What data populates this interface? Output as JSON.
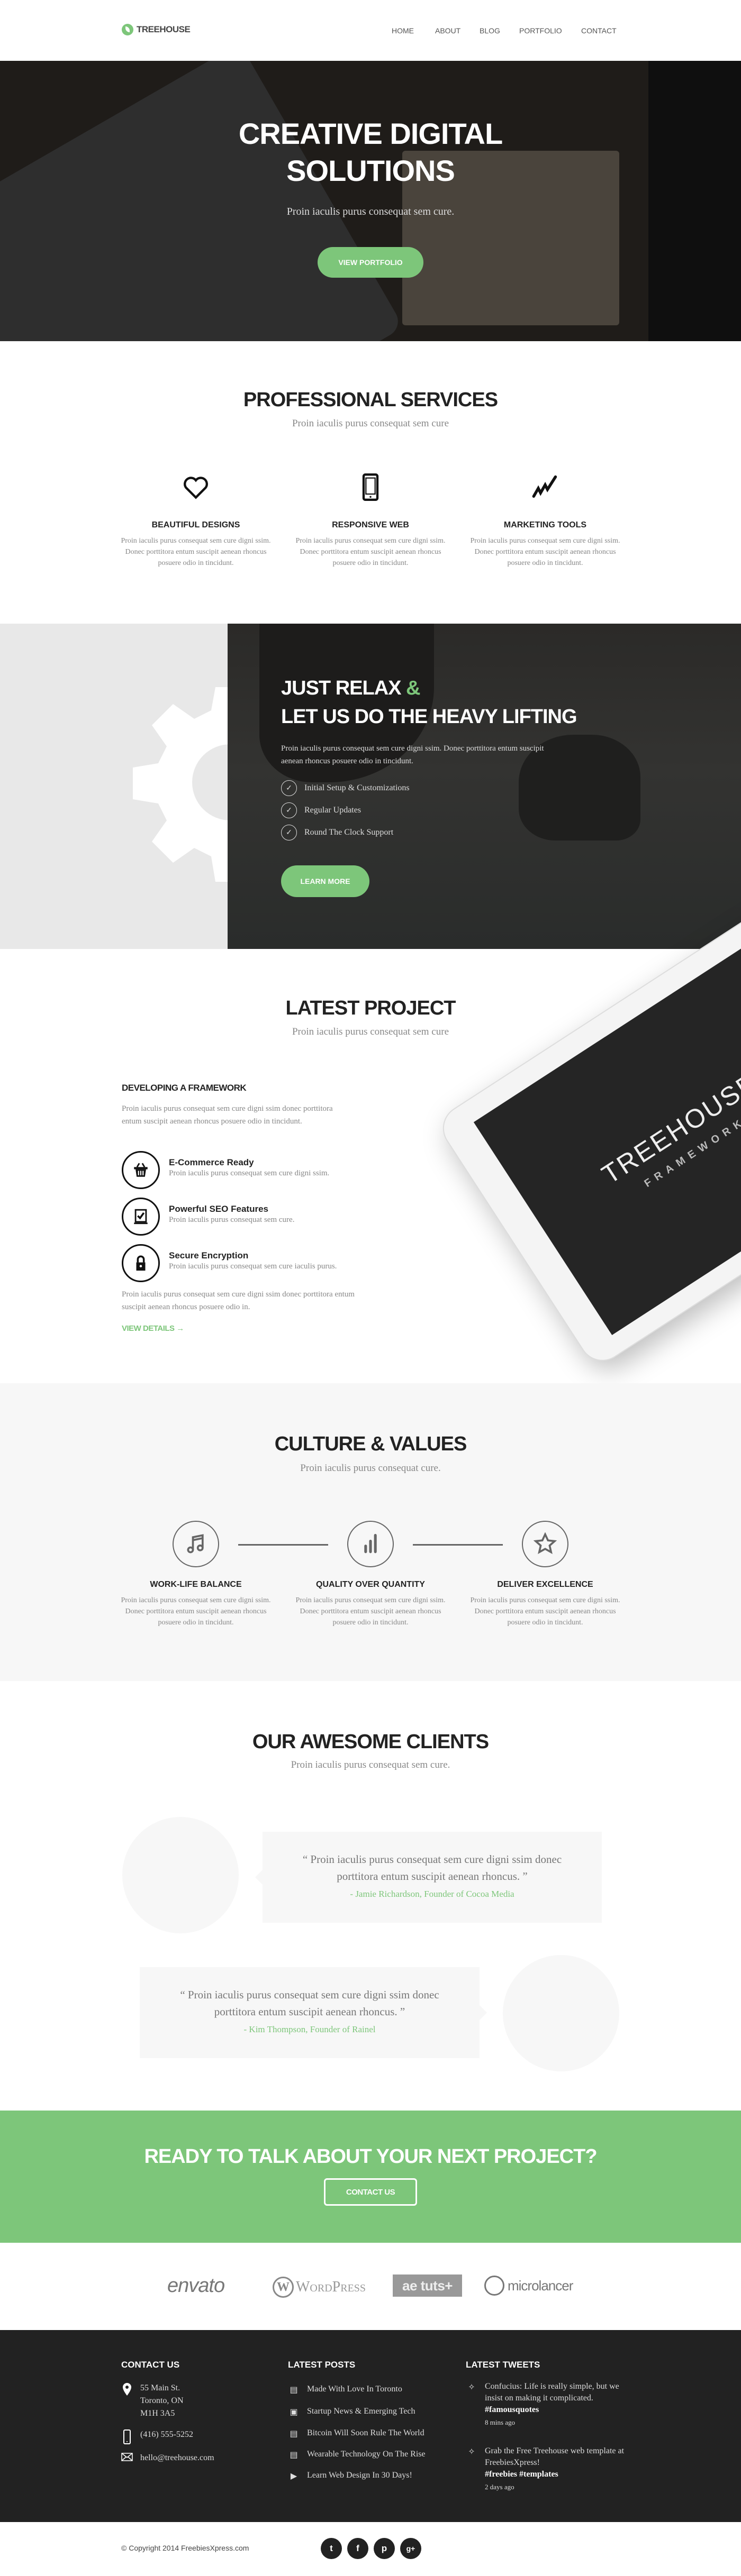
{
  "colors": {
    "accent": "#7dc67a",
    "footer": "#222222",
    "alt_bg": "#f7f7f7"
  },
  "header": {
    "logo": "TREEHOUSE",
    "nav": [
      "HOME",
      "ABOUT",
      "BLOG",
      "PORTFOLIO",
      "CONTACT"
    ]
  },
  "hero": {
    "title_line1": "CREATIVE DIGITAL",
    "title_line2": "SOLUTIONS",
    "subtitle": "Proin iaculis purus consequat sem cure.",
    "button": "VIEW PORTFOLIO"
  },
  "services": {
    "title": "PROFESSIONAL SERVICES",
    "subtitle": "Proin iaculis purus consequat sem cure",
    "items": [
      {
        "icon": "heart-icon",
        "title": "BEAUTIFUL DESIGNS",
        "text": "Proin iaculis purus consequat sem cure digni ssim. Donec porttitora entum suscipit aenean rhoncus posuere odio in tincidunt."
      },
      {
        "icon": "tablet-icon",
        "title": "RESPONSIVE WEB",
        "text": "Proin iaculis purus consequat sem cure digni ssim. Donec porttitora entum suscipit aenean rhoncus posuere odio in tincidunt."
      },
      {
        "icon": "trend-icon",
        "title": "MARKETING TOOLS",
        "text": "Proin iaculis purus consequat sem cure digni ssim. Donec porttitora entum suscipit aenean rhoncus posuere odio in tincidunt."
      }
    ]
  },
  "relax": {
    "title_a": "JUST RELAX",
    "title_amp": "&",
    "title_b": "LET US DO THE HEAVY LIFTING",
    "text": "Proin iaculis purus consequat sem cure  digni ssim. Donec porttitora entum suscipit  aenean rhoncus posuere odio in tincidunt.",
    "list": [
      "Initial Setup & Customizations",
      "Regular Updates",
      "Round The Clock Support"
    ],
    "button": "LEARN MORE"
  },
  "project": {
    "title": "LATEST PROJECT",
    "subtitle": "Proin iaculis purus consequat sem cure",
    "heading": "DEVELOPING A FRAMEWORK",
    "intro": "Proin iaculis purus consequat sem cure  digni ssim donec porttitora entum suscipit  aenean rhoncus posuere odio in tincidunt.",
    "features": [
      {
        "icon": "basket-icon",
        "title": "E-Commerce Ready",
        "text": "Proin iaculis purus consequat sem cure  digni ssim."
      },
      {
        "icon": "checked-screen-icon",
        "title": "Powerful SEO Features",
        "text": "Proin iaculis purus consequat sem cure."
      },
      {
        "icon": "lock-icon",
        "title": "Secure Encryption",
        "text": "Proin iaculis purus consequat sem cure iaculis purus."
      }
    ],
    "outro": "Proin iaculis purus consequat sem cure  digni ssim donec porttitora entum suscipit  aenean rhoncus posuere odio in.",
    "link": "VIEW DETAILS →",
    "tablet_brand": "TREEHOUSE",
    "tablet_sub": "FRAMEWORK"
  },
  "culture": {
    "title": "CULTURE & VALUES",
    "subtitle": "Proin iaculis purus consequat cure.",
    "items": [
      {
        "icon": "music-icon",
        "title": "WORK-LIFE BALANCE",
        "text": "Proin iaculis purus consequat sem cure digni ssim. Donec porttitora entum suscipit aenean rhoncus posuere odio in tincidunt."
      },
      {
        "icon": "bar-chart-icon",
        "title": "QUALITY OVER QUANTITY",
        "text": "Proin iaculis purus consequat sem cure digni ssim. Donec porttitora entum suscipit aenean rhoncus posuere odio in tincidunt."
      },
      {
        "icon": "star-icon",
        "title": "DELIVER EXCELLENCE",
        "text": "Proin iaculis purus consequat sem cure digni ssim. Donec porttitora entum suscipit aenean rhoncus posuere odio in tincidunt."
      }
    ]
  },
  "clients": {
    "title": "OUR AWESOME CLIENTS",
    "subtitle": "Proin iaculis purus consequat sem cure.",
    "testimonials": [
      {
        "quote": "“ Proin iaculis purus consequat sem cure  digni ssim donec porttitora entum suscipit aenean rhoncus. ”",
        "author": "- Jamie Richardson, Founder of Cocoa Media"
      },
      {
        "quote": "“ Proin iaculis purus consequat sem cure  digni ssim donec porttitora entum suscipit aenean rhoncus. ”",
        "author": "- Kim Thompson, Founder of Rainel"
      }
    ]
  },
  "cta": {
    "title": "READY TO TALK ABOUT YOUR NEXT PROJECT?",
    "button": "CONTACT US"
  },
  "partners": [
    "envato",
    "WordPress",
    "ae tuts+",
    "microlancer"
  ],
  "footer": {
    "contact": {
      "title": "CONTACT US",
      "address": [
        "55 Main St.",
        "Toronto, ON",
        "M1H 3A5"
      ],
      "phone": "(416) 555-5252",
      "email": "hello@treehouse.com"
    },
    "posts": {
      "title": "LATEST POSTS",
      "items": [
        "Made With Love In Toronto",
        "Startup News & Emerging Tech",
        "Bitcoin Will Soon Rule The World",
        "Wearable Technology On The Rise",
        "Learn Web Design In 30 Days!"
      ]
    },
    "tweets": {
      "title": "LATEST TWEETS",
      "items": [
        {
          "text": "Confucius: Life is really simple, but we insist on making it complicated.",
          "tag": "#famousquotes",
          "time": "8 mins ago"
        },
        {
          "text": "Grab the Free Treehouse web template at FreebiesXpress!",
          "tag": "#freebies #templates",
          "time": "2 days ago"
        }
      ]
    },
    "copyright": "© Copyright 2014 FreebiesXpress.com",
    "social": [
      "t",
      "f",
      "p",
      "g+"
    ]
  }
}
